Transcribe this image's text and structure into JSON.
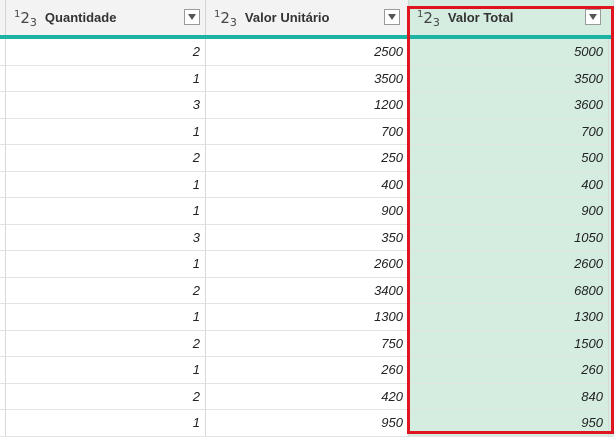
{
  "columns": [
    {
      "type_icon": "number-type-icon",
      "name": "Quantidade"
    },
    {
      "type_icon": "number-type-icon",
      "name": "Valor Unitário"
    },
    {
      "type_icon": "number-type-icon",
      "name": "Valor Total"
    }
  ],
  "type_icon_glyph": {
    "a": "1",
    "b": "2",
    "c": "3"
  },
  "rows": [
    {
      "quantidade": "2",
      "valor_unitario": "2500",
      "valor_total": "5000"
    },
    {
      "quantidade": "1",
      "valor_unitario": "3500",
      "valor_total": "3500"
    },
    {
      "quantidade": "3",
      "valor_unitario": "1200",
      "valor_total": "3600"
    },
    {
      "quantidade": "1",
      "valor_unitario": "700",
      "valor_total": "700"
    },
    {
      "quantidade": "2",
      "valor_unitario": "250",
      "valor_total": "500"
    },
    {
      "quantidade": "1",
      "valor_unitario": "400",
      "valor_total": "400"
    },
    {
      "quantidade": "1",
      "valor_unitario": "900",
      "valor_total": "900"
    },
    {
      "quantidade": "3",
      "valor_unitario": "350",
      "valor_total": "1050"
    },
    {
      "quantidade": "1",
      "valor_unitario": "2600",
      "valor_total": "2600"
    },
    {
      "quantidade": "2",
      "valor_unitario": "3400",
      "valor_total": "6800"
    },
    {
      "quantidade": "1",
      "valor_unitario": "1300",
      "valor_total": "1300"
    },
    {
      "quantidade": "2",
      "valor_unitario": "750",
      "valor_total": "1500"
    },
    {
      "quantidade": "1",
      "valor_unitario": "260",
      "valor_total": "260"
    },
    {
      "quantidade": "2",
      "valor_unitario": "420",
      "valor_total": "840"
    },
    {
      "quantidade": "1",
      "valor_unitario": "950",
      "valor_total": "950"
    }
  ],
  "colors": {
    "header_bg": "#f3f3f3",
    "header_accent": "#1bb3a3",
    "selected_column_bg": "#d4ede0",
    "highlight_border": "#e0141e"
  }
}
